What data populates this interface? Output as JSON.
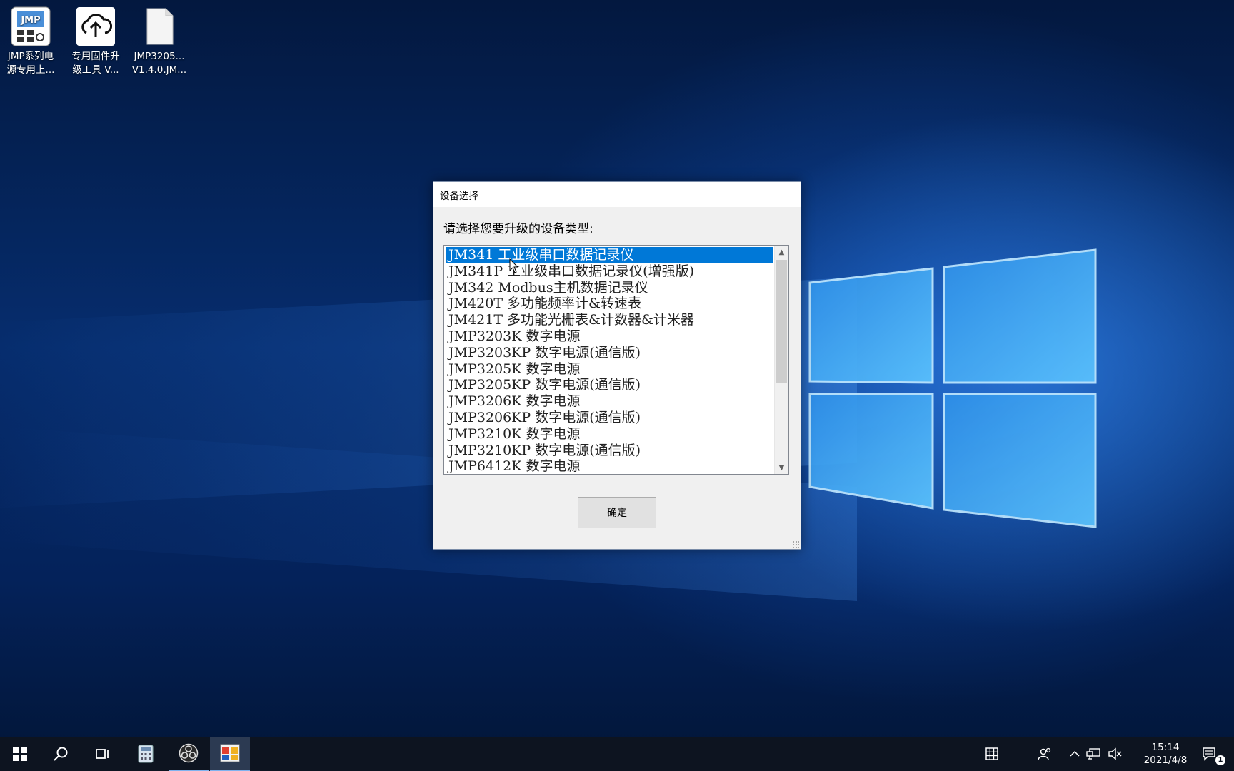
{
  "desktop": {
    "icons": [
      {
        "label": "JMP系列电\n源专用上...",
        "icon": "jmp-app-icon"
      },
      {
        "label": "专用固件升\n级工具 V...",
        "icon": "cloud-upload-icon"
      },
      {
        "label": "JMP3205...\nV1.4.0.JM...",
        "icon": "file-icon"
      }
    ]
  },
  "dialog": {
    "title": "设备选择",
    "prompt": "请选择您要升级的设备类型:",
    "items": [
      "JM341 工业级串口数据记录仪",
      "JM341P 工业级串口数据记录仪(增强版)",
      "JM342 Modbus主机数据记录仪",
      "JM420T 多功能频率计&转速表",
      "JM421T 多功能光栅表&计数器&计米器",
      "JMP3203K 数字电源",
      "JMP3203KP 数字电源(通信版)",
      "JMP3205K 数字电源",
      "JMP3205KP 数字电源(通信版)",
      "JMP3206K 数字电源",
      "JMP3206KP 数字电源(通信版)",
      "JMP3210K 数字电源",
      "JMP3210KP 数字电源(通信版)",
      "JMP6412K 数字电源"
    ],
    "selected_index": 0,
    "ok_label": "确定"
  },
  "taskbar": {
    "time": "15:14",
    "date": "2021/4/8",
    "notification_count": "1"
  },
  "colors": {
    "selection": "#0078d7",
    "taskbar": "#0d1420"
  }
}
